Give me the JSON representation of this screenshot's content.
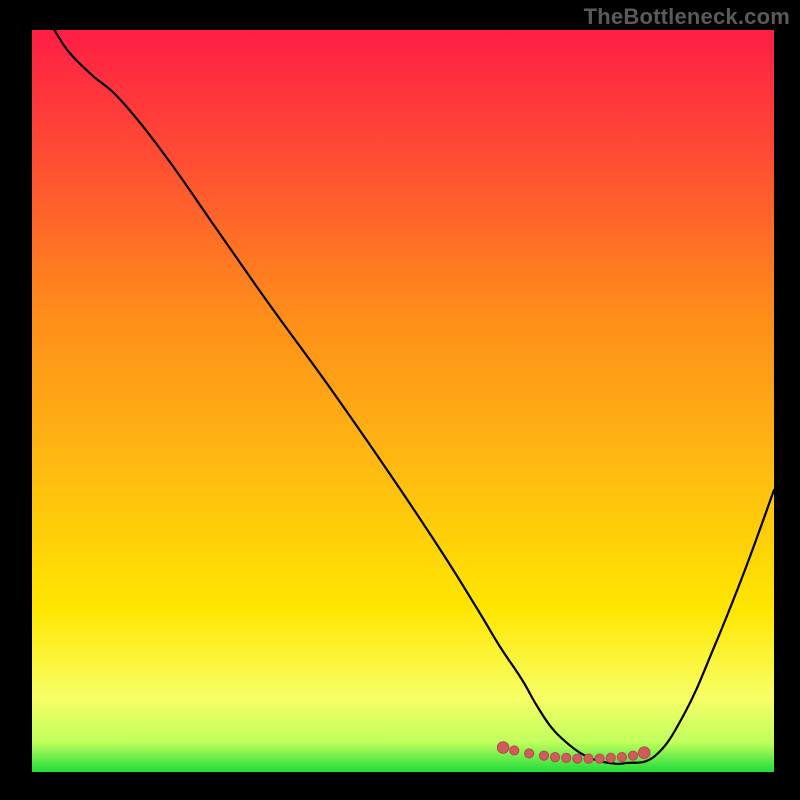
{
  "watermark": "TheBottleneck.com",
  "colors": {
    "background": "#000000",
    "gradient_top": "#ff1e45",
    "gradient_mid_upper": "#ff6a2b",
    "gradient_mid": "#ffb812",
    "gradient_mid_lower": "#ffe600",
    "gradient_low": "#f6ff5a",
    "gradient_bottom": "#1fdc3a",
    "curve": "#000000",
    "marker_fill": "#cd5c5c",
    "marker_stroke": "#b94a4a"
  },
  "chart_data": {
    "type": "line",
    "title": "",
    "xlabel": "",
    "ylabel": "",
    "xlim": [
      0,
      100
    ],
    "ylim": [
      0,
      100
    ],
    "series": [
      {
        "name": "bottleneck-curve",
        "x": [
          3,
          5,
          8,
          12,
          18,
          25,
          32,
          40,
          48,
          55,
          60,
          63,
          66,
          68,
          70,
          72,
          74,
          76,
          78,
          80,
          84,
          88,
          92,
          96,
          100
        ],
        "y": [
          100,
          97,
          94,
          90.5,
          83,
          73,
          63,
          52,
          40.5,
          30,
          22,
          17,
          12.5,
          9,
          6,
          4,
          2.5,
          1.6,
          1.2,
          1.2,
          2.2,
          8,
          17,
          27,
          38
        ]
      }
    ],
    "markers": {
      "name": "highlighted-range",
      "x": [
        63.5,
        65,
        67,
        69,
        70.5,
        72,
        73.5,
        75,
        76.5,
        78,
        79.5,
        81,
        82.5
      ],
      "y": [
        3.3,
        2.9,
        2.5,
        2.2,
        2.0,
        1.9,
        1.8,
        1.8,
        1.8,
        1.9,
        2.0,
        2.2,
        2.6
      ]
    }
  }
}
